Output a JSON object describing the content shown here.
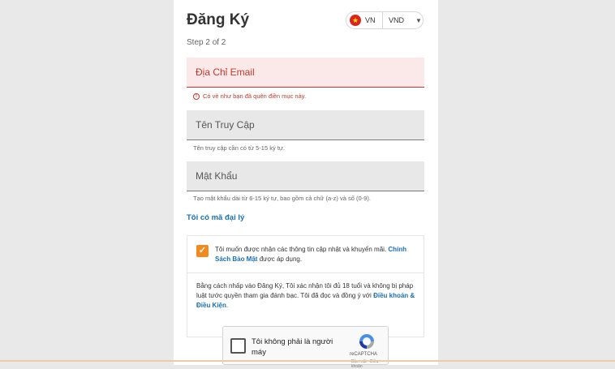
{
  "header": {
    "title": "Đăng Ký",
    "language_code": "VN",
    "currency": "VND",
    "flag_icon": "vietnam-flag-icon",
    "flag_colors": {
      "field": "#d9251d",
      "star": "#ffde00"
    }
  },
  "step": "Step 2 of 2",
  "fields": {
    "email": {
      "label": "Địa Chỉ Email",
      "error": "Có vẻ như bạn đã quên điền mục này."
    },
    "username": {
      "label": "Tên Truy Cập",
      "help": "Tên truy cập cần có từ 5-15 ký tự."
    },
    "password": {
      "label": "Mật Khẩu",
      "help": "Tạo mật khẩu dài từ 6-15 ký tự, bao gồm cả chữ (a-z) và số (0-9)."
    }
  },
  "agent_link": "Tôi có mã đại lý",
  "consent": {
    "checked": true,
    "text": "Tôi muốn được nhận các thông tin cập nhật và khuyến mãi. ",
    "policy_link": "Chính Sách Bảo Mật",
    "text_after": " được áp dụng."
  },
  "terms": {
    "text": "Bằng cách nhấp vào Đăng Ký, Tôi xác nhận tôi đủ 18 tuổi và không bị pháp luật tước quyền tham gia đánh bạc. Tôi đã đọc và đồng ý với ",
    "link": "Điều khoản & Điều Kiện",
    "text_after": "."
  },
  "recaptcha": {
    "label": "Tôi không phải là người máy",
    "brand": "reCAPTCHA",
    "sub": "Bảo mật - Điều khoản"
  },
  "colors": {
    "accent_orange": "#f28a1e",
    "link_blue": "#1a6fb5",
    "error_red": "#c0392b"
  }
}
